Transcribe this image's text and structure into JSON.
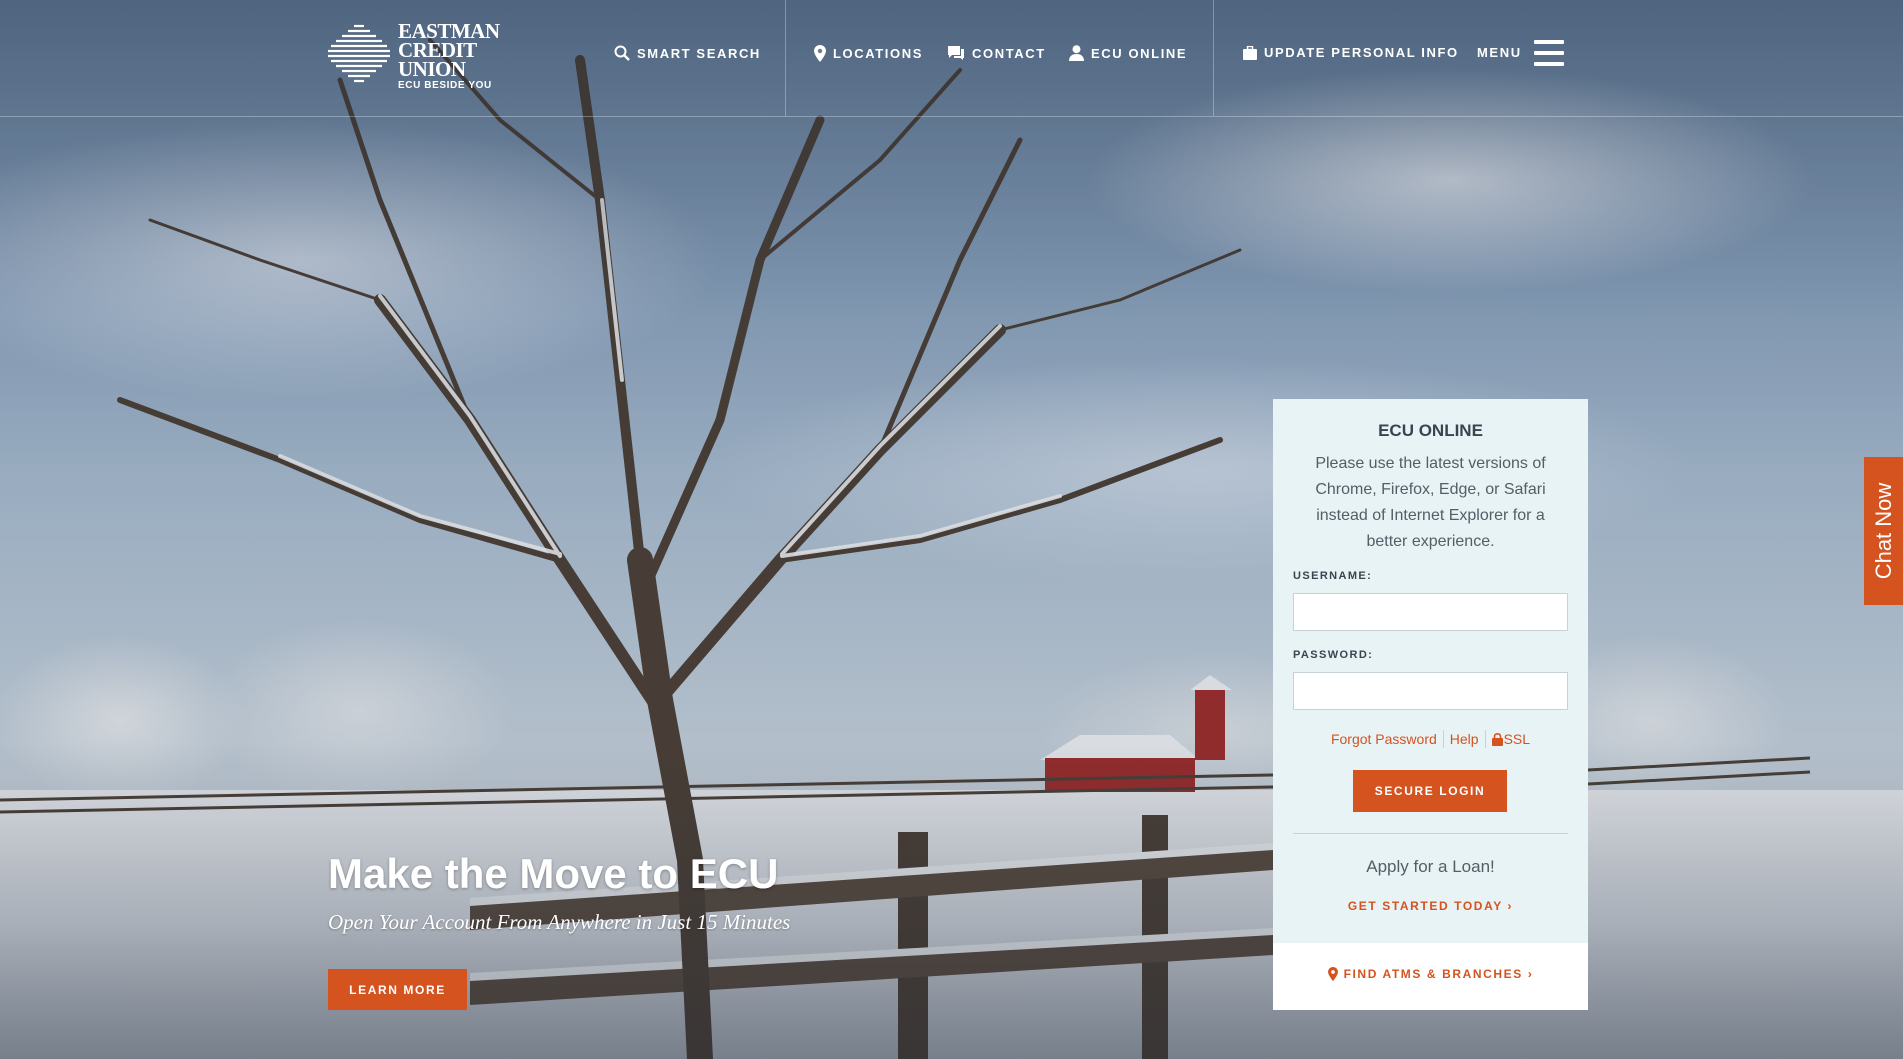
{
  "brand": {
    "logo_lines": [
      "EASTMAN",
      "CREDIT",
      "UNION"
    ],
    "tagline": "ECU BESIDE YOU"
  },
  "nav": {
    "smart_search": "SMART SEARCH",
    "locations": "LOCATIONS",
    "contact": "CONTACT",
    "ecu_online": "ECU ONLINE",
    "update_info": "UPDATE PERSONAL INFO",
    "menu": "MENU"
  },
  "hero": {
    "title": "Make the Move to ECU",
    "subtitle": "Open Your Account From Anywhere in Just 15 Minutes",
    "cta": "LEARN MORE"
  },
  "login": {
    "title": "ECU ONLINE",
    "note": "Please use the latest versions of Chrome, Firefox, Edge, or Safari instead of Internet Explorer for a better experience.",
    "username_label": "USERNAME:",
    "username_value": "",
    "password_label": "PASSWORD:",
    "password_value": "",
    "forgot_password": "Forgot Password",
    "help": "Help",
    "ssl": "SSL",
    "submit": "SECURE LOGIN",
    "apply_text": "Apply for a Loan!",
    "get_started": "GET STARTED TODAY ›",
    "find_atms": "FIND ATMS & BRANCHES ›"
  },
  "chat": {
    "label": "Chat Now"
  },
  "colors": {
    "accent": "#d4531f",
    "panel_bg": "#e7f3f4",
    "text_dark": "#3a4450"
  }
}
